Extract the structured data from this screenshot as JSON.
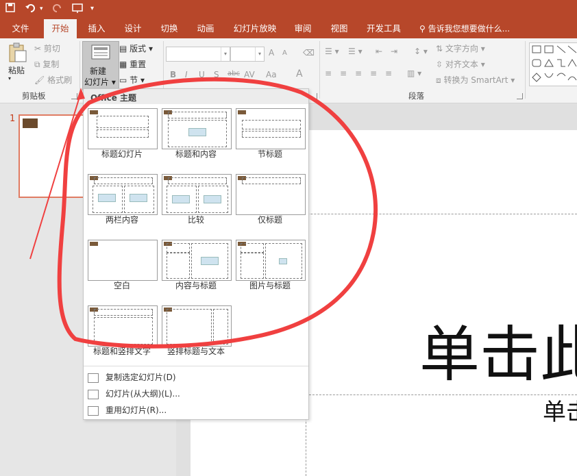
{
  "quick_access": {
    "save_icon": "save-icon",
    "undo_icon": "undo-icon",
    "redo_icon": "redo-icon",
    "present_icon": "present-from-start-icon",
    "customize_icon": "customize-qat-icon"
  },
  "tabs": [
    {
      "label": "文件"
    },
    {
      "label": "开始",
      "active": true
    },
    {
      "label": "插入"
    },
    {
      "label": "设计"
    },
    {
      "label": "切换"
    },
    {
      "label": "动画"
    },
    {
      "label": "幻灯片放映"
    },
    {
      "label": "审阅"
    },
    {
      "label": "视图"
    },
    {
      "label": "开发工具"
    }
  ],
  "tell_me": "告诉我您想要做什么...",
  "ribbon": {
    "clipboard": {
      "paste": "粘贴",
      "cut": "剪切",
      "copy": "复制",
      "format_painter": "格式刷",
      "group_label": "剪贴板"
    },
    "slides": {
      "new_slide_line1": "新建",
      "new_slide_line2": "幻灯片",
      "layout": "版式",
      "reset": "重置",
      "section": "节"
    },
    "font": {
      "bold": "B",
      "italic": "I",
      "underline": "U",
      "shadow": "S",
      "strike": "abc",
      "spacing": "AV",
      "case": "Aa",
      "grow": "A",
      "shrink": "A",
      "color": "A"
    },
    "paragraph": {
      "text_direction": "文字方向",
      "align_text": "对齐文本",
      "smartart": "转换为 SmartArt",
      "group_label": "段落"
    }
  },
  "layout_menu": {
    "header": "Office 主题",
    "layouts": [
      {
        "label": "标题幻灯片"
      },
      {
        "label": "标题和内容"
      },
      {
        "label": "节标题"
      },
      {
        "label": "两栏内容"
      },
      {
        "label": "比较"
      },
      {
        "label": "仅标题"
      },
      {
        "label": "空白"
      },
      {
        "label": "内容与标题"
      },
      {
        "label": "图片与标题"
      },
      {
        "label": "标题和竖排文字"
      },
      {
        "label": "竖排标题与文本"
      }
    ],
    "actions": [
      {
        "label": "复制选定幻灯片(D)"
      },
      {
        "label": "幻灯片(从大纲)(L)..."
      },
      {
        "label": "重用幻灯片(R)..."
      }
    ]
  },
  "slide_pane": {
    "slide_number": "1"
  },
  "slide": {
    "title_placeholder": "单击此",
    "subtitle_placeholder": "单击"
  },
  "colors": {
    "accent": "#b7472a",
    "annotation_red": "#f04040"
  }
}
